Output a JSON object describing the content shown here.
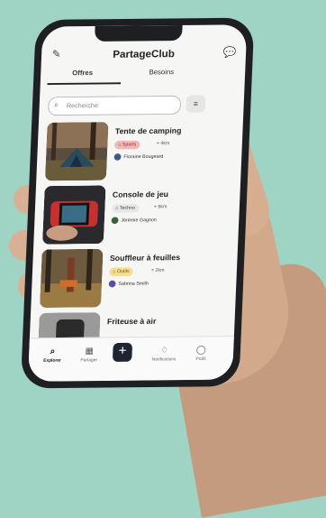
{
  "app": {
    "title": "PartageClub"
  },
  "tabs": [
    {
      "label": "Offres"
    },
    {
      "label": "Besoins"
    }
  ],
  "search": {
    "placeholder": "Recherche"
  },
  "items": [
    {
      "title": "Tente de camping",
      "badge": "Sports",
      "distance": "4km",
      "owner": "Floraine Bougeard"
    },
    {
      "title": "Console de jeu",
      "badge": "Techno",
      "distance": "6km",
      "owner": "Jérémie Gagnon"
    },
    {
      "title": "Souffleur à feuilles",
      "badge": "Outils",
      "distance": "2km",
      "owner": "Sabrina Smith"
    },
    {
      "title": "Friteuse à air"
    }
  ],
  "nav": [
    {
      "label": "Explorer"
    },
    {
      "label": "Partager"
    },
    {
      "label": "Notifications"
    },
    {
      "label": "Profil"
    }
  ],
  "icons": {
    "edit": "✎",
    "chat": "💬",
    "search": "⌕",
    "filter": "≡",
    "pin": "⌖",
    "tag": "⌂",
    "nav_search": "⌕",
    "nav_share": "▦",
    "nav_plus": "+",
    "nav_bell": "♢",
    "nav_user": "◯"
  },
  "colors": {
    "background": "#9fd3c4",
    "badge_sports": "#f2b8b8",
    "badge_techno": "#e7e7e7",
    "badge_outils": "#f4df90"
  }
}
